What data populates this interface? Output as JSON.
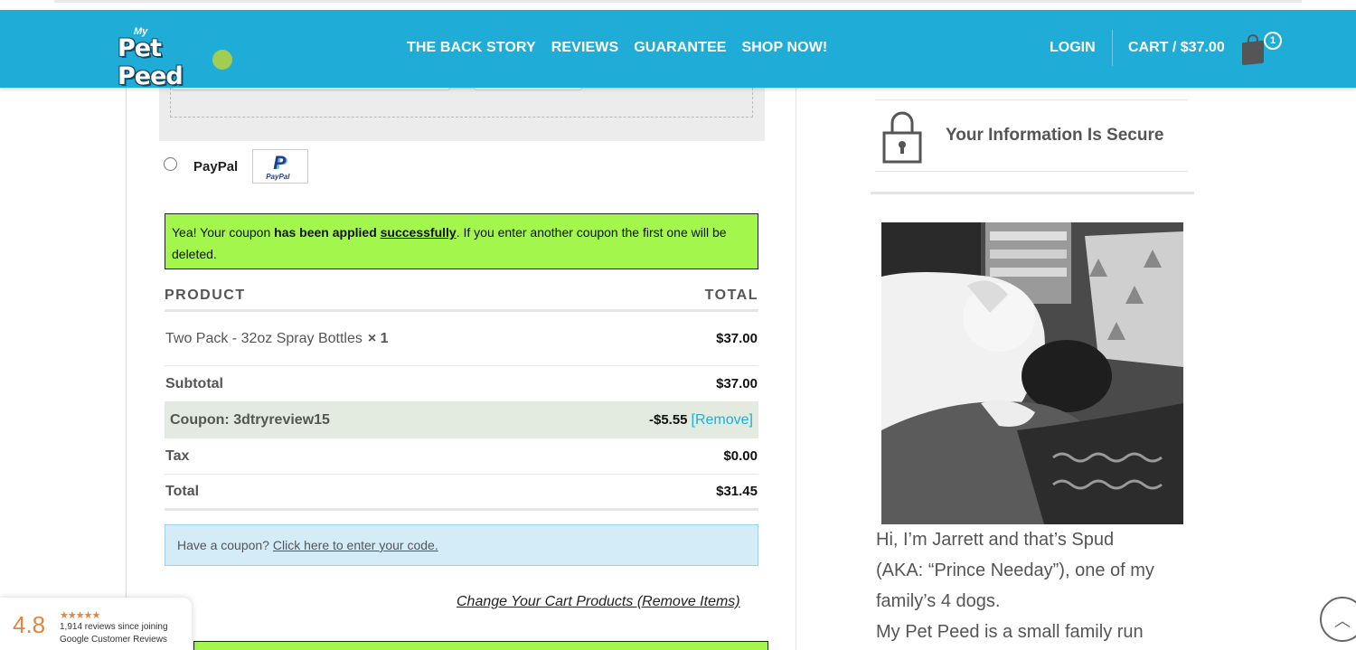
{
  "header": {
    "logo_text": "Pet Peed",
    "logo_prefix": "My",
    "nav": [
      "THE BACK STORY",
      "REVIEWS",
      "GUARANTEE",
      "SHOP NOW!"
    ],
    "login": "LOGIN",
    "cart": "CART / $37.00",
    "cart_count": "1",
    "accent_color": "#1fadd8"
  },
  "payment": {
    "paypal_label": "PayPal",
    "paypal_logo_text": "PayPal"
  },
  "notice": {
    "part1": "Yea! Your coupon ",
    "bold": "has been applied",
    "space": " ",
    "underlined": "successfully",
    "part2": ". If you enter another coupon the first one will be deleted.",
    "color": "#a3f64c"
  },
  "order": {
    "col_product": "PRODUCT",
    "col_total": "TOTAL",
    "item_name": "Two Pack - 32oz Spray Bottles",
    "item_qty": "× 1",
    "item_price": "$37.00",
    "subtotal_label": "Subtotal",
    "subtotal_value": "$37.00",
    "coupon_label": "Coupon: 3dtryreview15",
    "coupon_value": "-$5.55",
    "coupon_remove": "[Remove]",
    "tax_label": "Tax",
    "tax_value": "$0.00",
    "total_label": "Total",
    "total_value": "$31.45"
  },
  "coupon_prompt": {
    "text": "Have a coupon?",
    "link": "Click here to enter your code."
  },
  "change_cart_link": "Change Your Cart Products (Remove Items)",
  "reviews_widget": {
    "score": "4.8",
    "stars": "★★★★★",
    "line1": "1,914 reviews since joining",
    "line2": "Google Customer Reviews"
  },
  "sidebar": {
    "secure_text": "Your Information Is Secure",
    "bio_lines": [
      "Hi, I’m Jarrett and that’s Spud",
      "(AKA: “Prince Needay”), one of my",
      "family’s 4 dogs.",
      "My Pet Peed is a small family run"
    ]
  },
  "icons": {
    "lock": "lock-icon",
    "bag": "shopping-bag-icon",
    "scroll": "chevron-up-icon"
  }
}
